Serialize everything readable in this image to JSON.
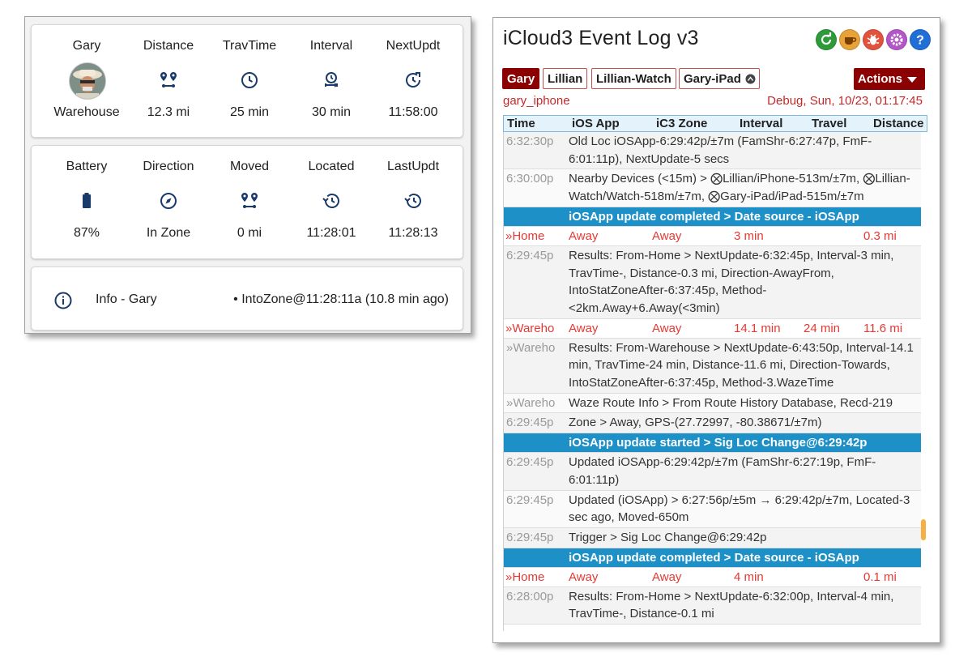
{
  "tracker": {
    "row1": [
      {
        "header": "Gary",
        "icon": "avatar",
        "value": "Warehouse"
      },
      {
        "header": "Distance",
        "icon": "map-markers-path-icon",
        "value": "12.3 mi"
      },
      {
        "header": "TravTime",
        "icon": "clock-icon",
        "value": "25 min"
      },
      {
        "header": "Interval",
        "icon": "timer-interval-icon",
        "value": "30 min"
      },
      {
        "header": "NextUpdt",
        "icon": "clock-refresh-icon",
        "value": "11:58:00"
      }
    ],
    "row2": [
      {
        "header": "Battery",
        "icon": "battery-icon",
        "value": "87%"
      },
      {
        "header": "Direction",
        "icon": "compass-icon",
        "value": "In Zone"
      },
      {
        "header": "Moved",
        "icon": "map-markers-path-icon",
        "value": "0 mi"
      },
      {
        "header": "Located",
        "icon": "history-icon",
        "value": "11:28:01"
      },
      {
        "header": "LastUpdt",
        "icon": "history-icon",
        "value": "11:28:13"
      }
    ],
    "info": {
      "icon": "info-icon",
      "title": "Info - Gary",
      "state": "• IntoZone@11:28:11a (10.8 min ago)"
    }
  },
  "event_log": {
    "title": "iCloud3 Event Log v3",
    "header_icons": [
      {
        "name": "refresh-icon",
        "color": "#2e9b3a"
      },
      {
        "name": "coffee-icon",
        "color": "#e8a23a"
      },
      {
        "name": "bug-icon",
        "color": "#e2533e"
      },
      {
        "name": "settings-icon",
        "color": "#b455c8"
      },
      {
        "name": "help-icon",
        "color": "#1f6fd6"
      }
    ],
    "tabs": [
      {
        "label": "Gary",
        "active": true
      },
      {
        "label": "Lillian",
        "active": false
      },
      {
        "label": "Lillian-Watch",
        "active": false
      },
      {
        "label": "Gary-iPad",
        "active": false,
        "suffix_icon": "wifi-cell-icon"
      }
    ],
    "actions_label": "Actions",
    "device_name": "gary_iphone",
    "debug_info": "Debug, Sun, 10/23, 01:17:45",
    "columns": [
      "Time",
      "iOS App",
      "iC3 Zone",
      "Interval",
      "Travel",
      "Distance"
    ],
    "rows": [
      {
        "type": "gray",
        "time": "6:32:30p",
        "text": "Old Loc iOSApp-6:29:42p/±7m (FamShr-6:27:47p, FmF-6:01:11p), NextUpdate-5 secs"
      },
      {
        "type": "white",
        "time": "6:30:00p",
        "text": "Nearby Devices (<15m) > ⨂Lillian/iPhone-513m/±7m, ⨂Lillian-Watch/Watch-518m/±7m, ⨂Gary-iPad/iPad-515m/±7m"
      },
      {
        "type": "banner",
        "text": "iOSApp update completed > Date source - iOSApp"
      },
      {
        "type": "stats",
        "zone": "»Home",
        "ios": "Away",
        "ic3": "Away",
        "interval": "3 min",
        "travel": "",
        "distance": "0.3 mi"
      },
      {
        "type": "gray",
        "time": "6:29:45p",
        "text": "Results: From-Home > NextUpdate-6:32:45p, Interval-3 min, TravTime-, Distance-0.3 mi, Direction-AwayFrom, IntoStatZoneAfter-6:37:45p, Method-<2km.Away+6.Away(<3min)"
      },
      {
        "type": "stats",
        "zone": "»Wareho",
        "ios": "Away",
        "ic3": "Away",
        "interval": "14.1 min",
        "travel": "24 min",
        "distance": "11.6 mi"
      },
      {
        "type": "gray",
        "time": "»Wareho",
        "text": "Results: From-Warehouse > NextUpdate-6:43:50p, Interval-14.1 min, TravTime-24 min, Distance-11.6 mi, Direction-Towards, IntoStatZoneAfter-6:37:45p, Method-3.WazeTime"
      },
      {
        "type": "white",
        "time": "»Wareho",
        "text": "Waze Route Info > From Route History Database, Recd-219"
      },
      {
        "type": "gray",
        "time": "6:29:45p",
        "text": "Zone > Away, GPS-(27.72997, -80.38671/±7m)"
      },
      {
        "type": "banner",
        "text": "iOSApp update started > Sig Loc Change@6:29:42p"
      },
      {
        "type": "gray",
        "time": "6:29:45p",
        "text": "Updated iOSApp-6:29:42p/±7m (FamShr-6:27:19p, FmF-6:01:11p)"
      },
      {
        "type": "white",
        "time": "6:29:45p",
        "text": "Updated (iOSApp) > 6:27:56p/±5m → 6:29:42p/±7m, Located-3 sec ago, Moved-650m"
      },
      {
        "type": "gray",
        "time": "6:29:45p",
        "text": "Trigger > Sig Loc Change@6:29:42p"
      },
      {
        "type": "banner",
        "text": "iOSApp update completed > Date source - iOSApp"
      },
      {
        "type": "stats",
        "zone": "»Home",
        "ios": "Away",
        "ic3": "Away",
        "interval": "4 min",
        "travel": "",
        "distance": "0.1 mi"
      },
      {
        "type": "gray",
        "time": "6:28:00p",
        "text": "Results: From-Home > NextUpdate-6:32:00p, Interval-4 min, TravTime-, Distance-0.1 mi"
      }
    ]
  },
  "colors": {
    "accent_blue": "#1e90c8",
    "tab_red": "#8b0000",
    "stats_red": "#e53935",
    "icon_navy": "#1a3a6b"
  }
}
